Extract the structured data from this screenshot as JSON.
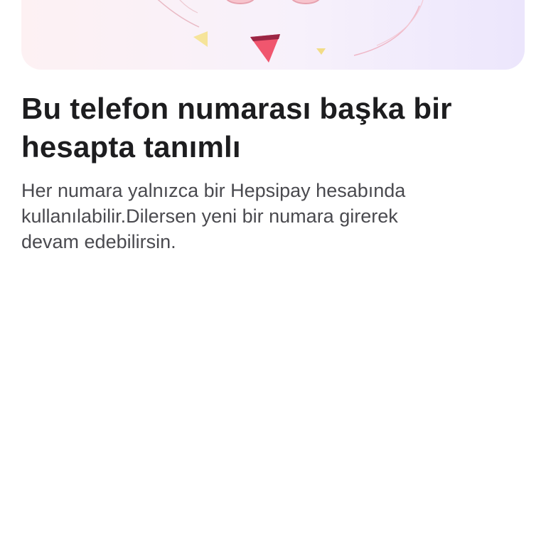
{
  "hero": {
    "illustration": "error-illustration",
    "colors": {
      "background_start": "#fdf1f3",
      "background_end": "#ece6fc",
      "accent_pink": "#f0566e",
      "accent_yellow": "#f6e49a"
    }
  },
  "content": {
    "title": "Bu telefon numarası başka bir hesapta tanımlı",
    "description": "Her numara yalnızca bir Hepsipay hesabında\nkullanılabilir.Dilersen yeni bir numara girerek\ndevam edebilirsin."
  }
}
